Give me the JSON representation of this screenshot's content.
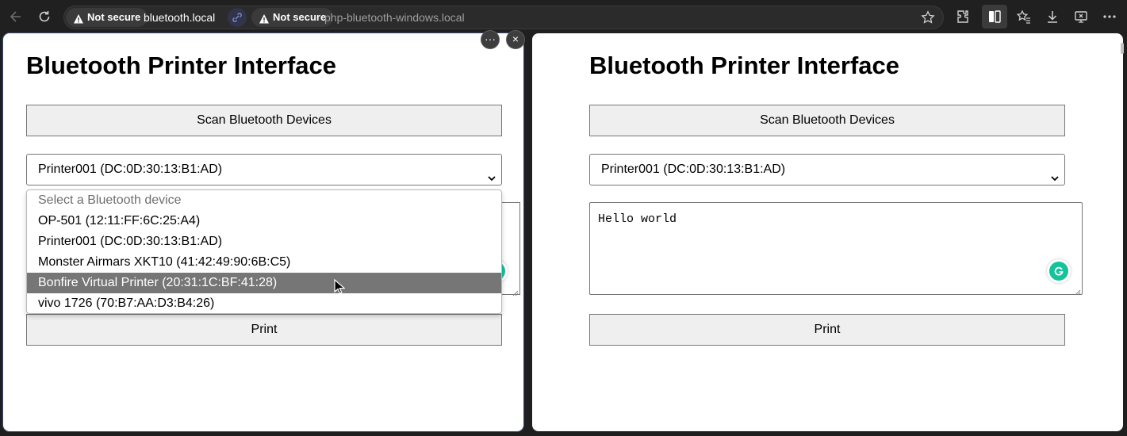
{
  "browser": {
    "tabs": [
      {
        "security_label": "Not secure",
        "host": "bluetooth.local"
      },
      {
        "security_label": "Not secure",
        "host": "php-bluetooth-windows.local"
      }
    ],
    "icons": [
      "back-icon",
      "refresh-icon",
      "warning-icon",
      "split-link-icon",
      "star-icon",
      "extensions-icon",
      "split-screen-icon",
      "favorites-icon",
      "downloads-icon",
      "screenshot-icon",
      "more-icon"
    ],
    "pane_controls": {
      "more": "···",
      "close": "×"
    }
  },
  "left_pane": {
    "heading": "Bluetooth Printer Interface",
    "scan_label": "Scan Bluetooth Devices",
    "selected_device": "Printer001 (DC:0D:30:13:B1:AD)",
    "dropdown_options": [
      "Select a Bluetooth device",
      "OP-501 (12:11:FF:6C:25:A4)",
      "Printer001 (DC:0D:30:13:B1:AD)",
      "Monster Airmars XKT10 (41:42:49:90:6B:C5)",
      "Bonfire Virtual Printer (20:31:1C:BF:41:28)",
      "vivo 1726 (70:B7:AA:D3:B4:26)"
    ],
    "highlighted_option": "Bonfire Virtual Printer (20:31:1C:BF:41:28)",
    "print_label": "Print"
  },
  "right_pane": {
    "heading": "Bluetooth Printer Interface",
    "scan_label": "Scan Bluetooth Devices",
    "selected_device": "Printer001 (DC:0D:30:13:B1:AD)",
    "message": "Hello world",
    "print_label": "Print"
  },
  "colors": {
    "chrome_bg": "#202020",
    "page_bg": "#ffffff",
    "button_bg": "#efefef",
    "option_highlight": "#767676",
    "grammarly": "#15c39a"
  }
}
